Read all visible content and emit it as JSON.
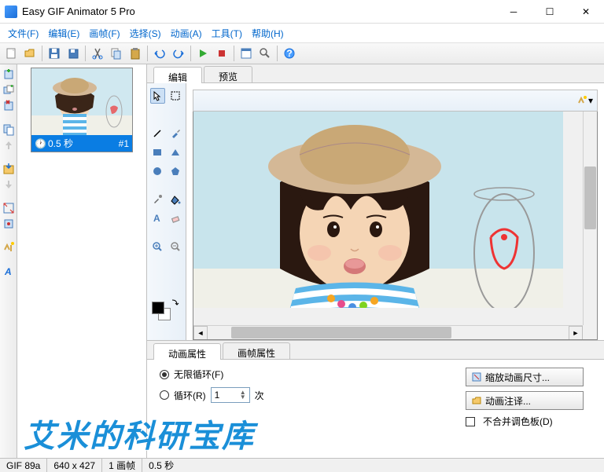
{
  "window": {
    "title": "Easy GIF Animator 5 Pro"
  },
  "menu": {
    "file": "文件(F)",
    "edit": "编辑(E)",
    "frame": "画帧(F)",
    "select": "选择(S)",
    "anim": "动画(A)",
    "tool": "工具(T)",
    "help": "帮助(H)"
  },
  "frame": {
    "delay": "0.5 秒",
    "index": "#1"
  },
  "tabs": {
    "edit": "编辑",
    "preview": "预览"
  },
  "props": {
    "tab_anim": "动画属性",
    "tab_frame": "画帧属性",
    "loop_inf": "无限循环(F)",
    "loop_n": "循环(R)",
    "loop_count": "1",
    "times": "次",
    "btn_resize": "缩放动画尺寸...",
    "btn_comment": "动画注译...",
    "chk_palette": "不合并调色板(D)"
  },
  "status": {
    "ver": "GIF 89a",
    "dim": "640 x 427",
    "frames": "1 画帧",
    "delay": "0.5 秒"
  },
  "watermark": "艾米的科研宝库"
}
